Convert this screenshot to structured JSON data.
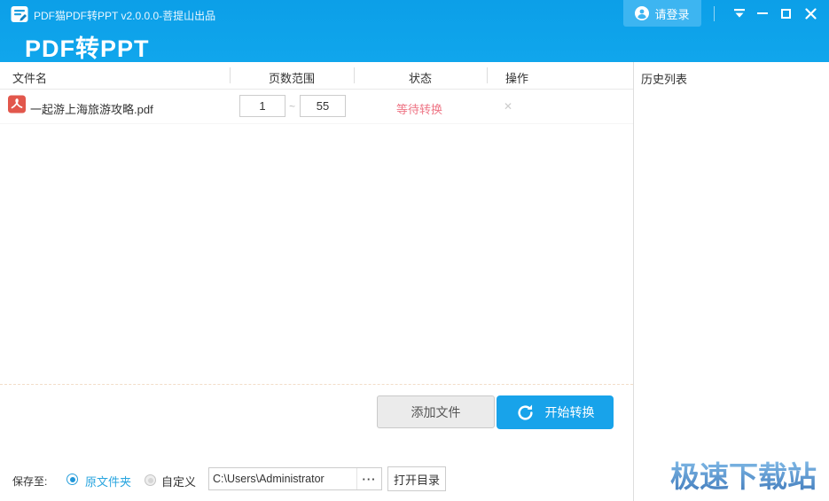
{
  "titlebar": {
    "title": "PDF猫PDF转PPT v2.0.0.0-菩提山出品",
    "login_label": "请登录"
  },
  "header": {
    "app_title": "PDF转PPT"
  },
  "table": {
    "columns": [
      "文件名",
      "页数范围",
      "状态",
      "操作"
    ],
    "range_separator": "~"
  },
  "files": [
    {
      "name": "一起游上海旅游攻略.pdf",
      "page_from": "1",
      "page_to": "55",
      "status": "等待转换"
    }
  ],
  "icons": {
    "delete_row": "✕",
    "dots": "···"
  },
  "sidebar": {
    "title": "历史列表"
  },
  "actions": {
    "add_file": "添加文件",
    "start_convert": "开始转换"
  },
  "save_bar": {
    "label": "保存至:",
    "option_original": "原文件夹",
    "option_custom": "自定义",
    "path_value": "C:\\Users\\Administrator",
    "open_dir": "打开目录"
  },
  "watermark": {
    "text": "极速下载站"
  },
  "colors": {
    "accent": "#0fa3e9",
    "login_button": "#3db5f1",
    "start_button": "#18a3ea",
    "status_waiting": "#ee7585",
    "link_blue": "#29a5df",
    "pdf_red": "#e2574c"
  }
}
